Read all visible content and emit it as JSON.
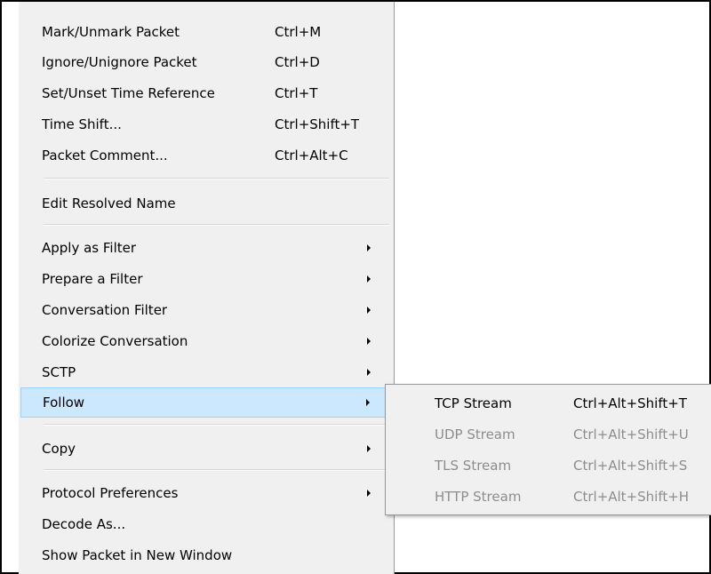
{
  "context_menu": {
    "items": [
      {
        "label": "Mark/Unmark Packet",
        "shortcut": "Ctrl+M"
      },
      {
        "label": "Ignore/Unignore Packet",
        "shortcut": "Ctrl+D"
      },
      {
        "label": "Set/Unset Time Reference",
        "shortcut": "Ctrl+T"
      },
      {
        "label": "Time Shift...",
        "shortcut": "Ctrl+Shift+T"
      },
      {
        "label": "Packet Comment...",
        "shortcut": "Ctrl+Alt+C"
      },
      {
        "label": "Edit Resolved Name"
      },
      {
        "label": "Apply as Filter",
        "submenu": true
      },
      {
        "label": "Prepare a Filter",
        "submenu": true
      },
      {
        "label": "Conversation Filter",
        "submenu": true
      },
      {
        "label": "Colorize Conversation",
        "submenu": true
      },
      {
        "label": "SCTP",
        "submenu": true
      },
      {
        "label": "Follow",
        "submenu": true,
        "highlighted": true
      },
      {
        "label": "Copy",
        "submenu": true
      },
      {
        "label": "Protocol Preferences",
        "submenu": true
      },
      {
        "label": "Decode As..."
      },
      {
        "label": "Show Packet in New Window"
      }
    ]
  },
  "follow_submenu": {
    "items": [
      {
        "label": "TCP Stream",
        "shortcut": "Ctrl+Alt+Shift+T",
        "enabled": true
      },
      {
        "label": "UDP Stream",
        "shortcut": "Ctrl+Alt+Shift+U",
        "enabled": false
      },
      {
        "label": "TLS Stream",
        "shortcut": "Ctrl+Alt+Shift+S",
        "enabled": false
      },
      {
        "label": "HTTP Stream",
        "shortcut": "Ctrl+Alt+Shift+H",
        "enabled": false
      }
    ]
  },
  "colors": {
    "menu_background": "#f0f0f0",
    "highlight_background": "#cce8ff",
    "highlight_border": "#99d1ff",
    "disabled_text": "#8d8d8d"
  },
  "icons": {
    "submenu_arrow": "chevron-right-icon"
  }
}
